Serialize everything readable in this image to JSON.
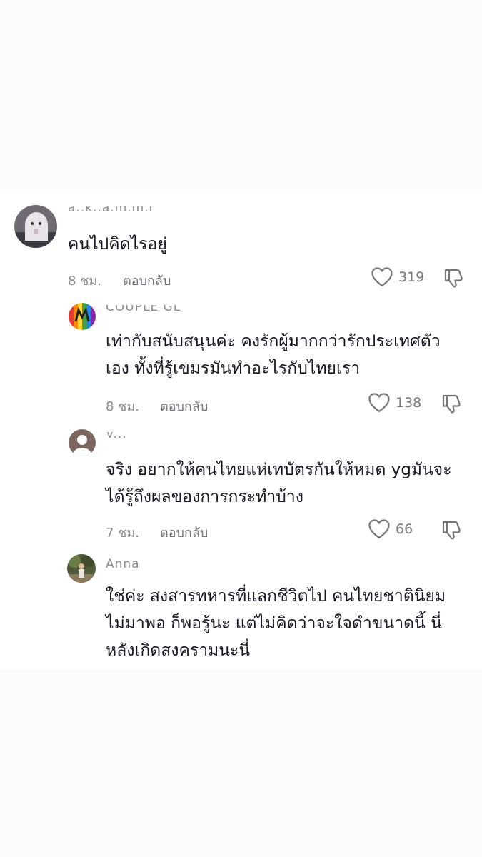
{
  "comments": [
    {
      "username": "a..k..a.m.m.r",
      "text": "คนไปคิดไรอยู่",
      "time": "8 ชม.",
      "reply_label": "ตอบกลับ",
      "likes": "319",
      "avatar_icon": "ghost-avatar-icon"
    },
    {
      "username": "COUPLE GL",
      "text": "เท่ากับสนับสนุนค่ะ คงรักผู้มากกว่ารักประเทศตัว\nเอง ทั้งที่รู้เขมรมันทำอะไรกับไทยเรา",
      "time": "8 ชม.",
      "reply_label": "ตอบกลับ",
      "likes": "138",
      "avatar_icon": "rainbow-avatar-icon"
    },
    {
      "username": "V...",
      "text": "จริง อยากให้คนไทยแห่เทบัตรกันให้หมด ygมันจะ\nได้รู้ถึงผลของการกระทำบ้าง",
      "time": "7 ชม.",
      "reply_label": "ตอบกลับ",
      "likes": "66",
      "avatar_icon": "default-person-avatar-icon"
    },
    {
      "username": "Anna",
      "text": "ใช่ค่ะ สงสารทหารที่แลกชีวิตไป คนไทยชาตินิยม\nไม่มาพอ ก็พอรู้นะ แต่ไม่คิดว่าจะใจดำขนาดนี้ นี่\nหลังเกิดสงครามนะนี่",
      "avatar_icon": "photo-avatar-icon"
    }
  ],
  "colors": {
    "text": "#161823",
    "secondary": "#8a8b91",
    "background": "#ffffff"
  }
}
